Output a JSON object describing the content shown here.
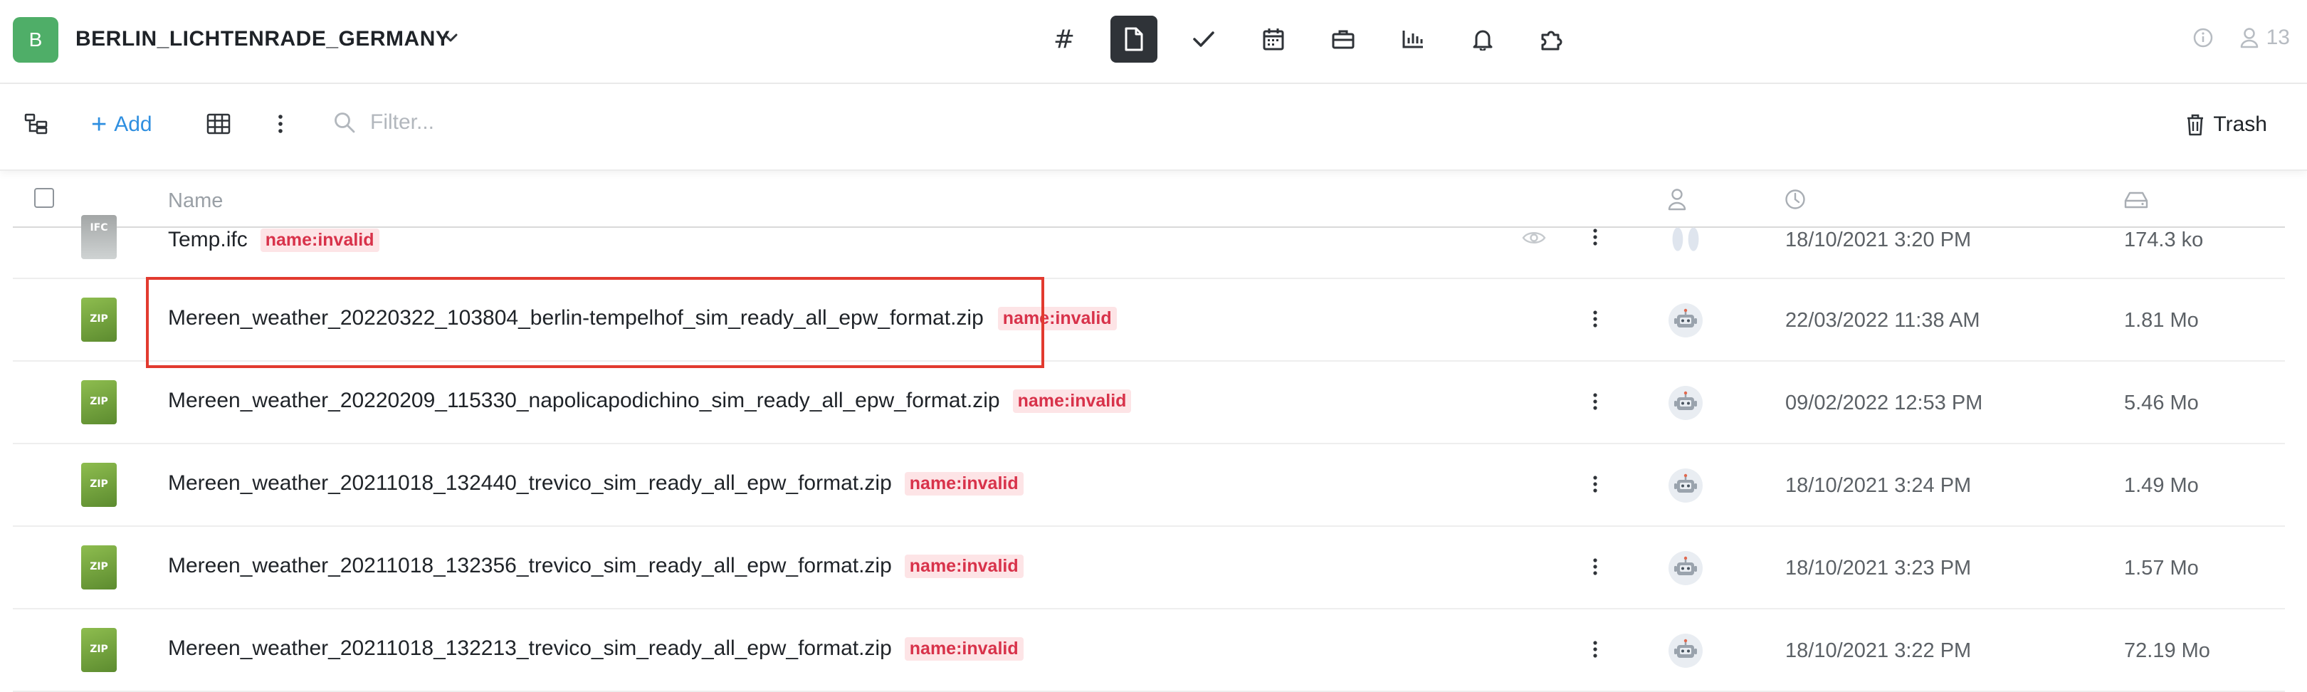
{
  "header": {
    "project_initial": "B",
    "project_name": "BERLIN_LICHTENRADE_GERMANY",
    "nav_items": [
      {
        "icon": "hash-icon",
        "label": "#",
        "active": false
      },
      {
        "icon": "document-icon",
        "active": true
      },
      {
        "icon": "check-icon",
        "active": false
      },
      {
        "icon": "calendar-icon",
        "active": false
      },
      {
        "icon": "briefcase-icon",
        "active": false
      },
      {
        "icon": "chart-icon",
        "active": false
      },
      {
        "icon": "bell-icon",
        "active": false
      },
      {
        "icon": "puzzle-icon",
        "active": false
      }
    ],
    "user_count": "13",
    "brand_color": "#4fae68"
  },
  "toolbar": {
    "add_label": "Add",
    "filter_placeholder": "Filter...",
    "trash_label": "Trash",
    "accent_color": "#2f8fe0"
  },
  "table": {
    "columns": {
      "name": "Name"
    },
    "rows": [
      {
        "type": "IFC",
        "name": "Temp.ifc",
        "tag": "name:invalid",
        "date": "18/10/2021 3:20 PM",
        "size": "174.3 ko",
        "avatar": "ghost"
      },
      {
        "type": "ZIP",
        "name": "Mereen_weather_20220322_103804_berlin-tempelhof_sim_ready_all_epw_format.zip",
        "tag": "name:invalid",
        "date": "22/03/2022 11:38 AM",
        "size": "1.81 Mo",
        "avatar": "robot"
      },
      {
        "type": "ZIP",
        "name": "Mereen_weather_20220209_115330_napolicapodichino_sim_ready_all_epw_format.zip",
        "tag": "name:invalid",
        "date": "09/02/2022 12:53 PM",
        "size": "5.46 Mo",
        "avatar": "robot"
      },
      {
        "type": "ZIP",
        "name": "Mereen_weather_20211018_132440_trevico_sim_ready_all_epw_format.zip",
        "tag": "name:invalid",
        "date": "18/10/2021 3:24 PM",
        "size": "1.49 Mo",
        "avatar": "robot"
      },
      {
        "type": "ZIP",
        "name": "Mereen_weather_20211018_132356_trevico_sim_ready_all_epw_format.zip",
        "tag": "name:invalid",
        "date": "18/10/2021 3:23 PM",
        "size": "1.57 Mo",
        "avatar": "robot"
      },
      {
        "type": "ZIP",
        "name": "Mereen_weather_20211018_132213_trevico_sim_ready_all_epw_format.zip",
        "tag": "name:invalid",
        "date": "18/10/2021 3:22 PM",
        "size": "72.19 Mo",
        "avatar": "robot"
      }
    ]
  },
  "colors": {
    "tag_bg": "#fde4e6",
    "tag_text": "#d8324a",
    "highlight": "#e23a2f"
  }
}
